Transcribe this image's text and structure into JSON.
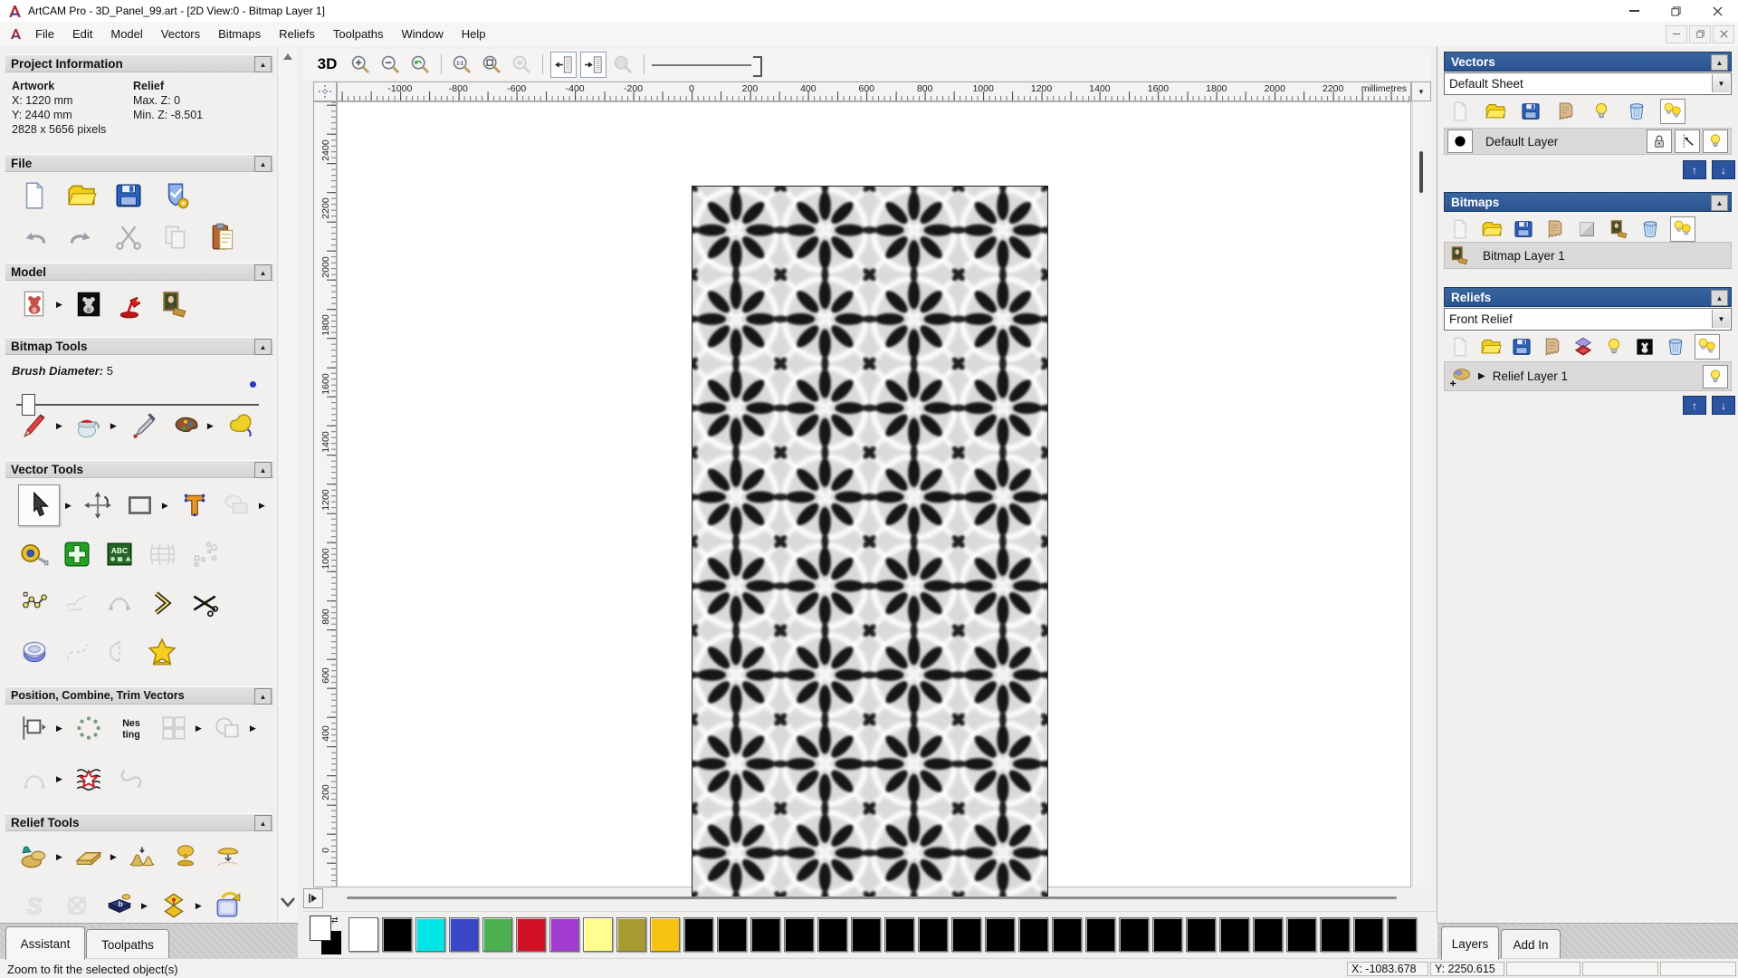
{
  "window": {
    "title": "ArtCAM Pro - 3D_Panel_99.art - [2D View:0 - Bitmap Layer 1]"
  },
  "menu": {
    "items": [
      "File",
      "Edit",
      "Model",
      "Vectors",
      "Bitmaps",
      "Reliefs",
      "Toolpaths",
      "Window",
      "Help"
    ]
  },
  "assistant": {
    "project_info": {
      "title": "Project Information",
      "artwork_label": "Artwork",
      "relief_label": "Relief",
      "x": "X: 1220 mm",
      "y": "Y: 2440 mm",
      "max_z": "Max. Z: 0",
      "min_z": "Min. Z: -8.501",
      "pixels": "2828 x 5656 pixels"
    },
    "section_titles": {
      "file": "File",
      "model": "Model",
      "bitmap": "Bitmap Tools",
      "vector": "Vector Tools",
      "position": "Position, Combine, Trim Vectors",
      "relief": "Relief Tools"
    },
    "brush_label": "Brush Diameter:",
    "brush_value": "5",
    "tabs": [
      {
        "label": "Assistant"
      },
      {
        "label": "Toolpaths"
      }
    ],
    "tools": {
      "file1": [
        {
          "n": "new-model",
          "s": "page"
        },
        {
          "n": "open-model",
          "s": "folder"
        },
        {
          "n": "save-model",
          "s": "floppy"
        },
        {
          "n": "model-properties",
          "s": "shield"
        }
      ],
      "file2": [
        {
          "n": "undo",
          "s": "undo"
        },
        {
          "n": "redo",
          "s": "redo"
        },
        {
          "n": "cut",
          "s": "scissors"
        },
        {
          "n": "copy",
          "s": "pages",
          "d": 1
        },
        {
          "n": "paste",
          "s": "clip"
        }
      ],
      "model": [
        {
          "n": "relief-preview",
          "s": "bear",
          "f": 1
        },
        {
          "n": "greyscale-view",
          "s": "beardark"
        },
        {
          "n": "light-material-settings",
          "s": "lamp"
        },
        {
          "n": "load-bitmap",
          "s": "mona"
        }
      ],
      "bitmap": [
        {
          "n": "paint-brush",
          "s": "pencil",
          "f": 1
        },
        {
          "n": "flood-fill",
          "s": "jar",
          "f": 1
        },
        {
          "n": "colour-picker",
          "s": "dropper"
        },
        {
          "n": "edit-palette",
          "s": "palette",
          "f": 1
        },
        {
          "n": "eraser",
          "s": "glove"
        }
      ],
      "vec1": [
        {
          "n": "select-vectors",
          "s": "cursor",
          "sel": 1,
          "f": 1
        },
        {
          "n": "transform-vectors",
          "s": "move"
        },
        {
          "n": "create-rectangle",
          "s": "recttool",
          "f": 1
        },
        {
          "n": "create-text",
          "s": "textT"
        },
        {
          "n": "create-ellipse",
          "s": "grayshapes",
          "d": 1,
          "f": 1
        }
      ],
      "vec2": [
        {
          "n": "measure-tool",
          "s": "tape"
        },
        {
          "n": "create-polyline",
          "s": "greencross"
        },
        {
          "n": "text-wizard",
          "s": "abc"
        },
        {
          "n": "envelope-distort",
          "s": "mesh",
          "d": 1
        },
        {
          "n": "paste-along-curve",
          "s": "dots",
          "d": 1
        }
      ],
      "vec3": [
        {
          "n": "node-editing",
          "s": "nodes"
        },
        {
          "n": "free-sketch",
          "s": "sketch",
          "d": 1
        },
        {
          "n": "fit-arcs",
          "s": "bezier",
          "d": 1
        },
        {
          "n": "vector-direction",
          "s": "chevron"
        },
        {
          "n": "trim-vectors",
          "s": "trim"
        }
      ],
      "vec4": [
        {
          "n": "fillet-tool",
          "s": "ring"
        },
        {
          "n": "smooth-vector",
          "s": "dashcurve",
          "d": 1
        },
        {
          "n": "mirror-vectors",
          "s": "halfgray",
          "d": 1
        },
        {
          "n": "vector-doctor",
          "s": "star"
        }
      ],
      "pos1": [
        {
          "n": "align-vectors",
          "s": "align",
          "f": 1
        },
        {
          "n": "circular-copy",
          "s": "circarray"
        },
        {
          "n": "nesting",
          "s": "nesting"
        },
        {
          "n": "block-copy",
          "s": "blockarray",
          "d": 1,
          "f": 1
        },
        {
          "n": "weld-vectors",
          "s": "weld",
          "d": 1,
          "f": 1
        }
      ],
      "pos2": [
        {
          "n": "join-vectors",
          "s": "joingray",
          "d": 1,
          "f": 1
        },
        {
          "n": "fit-vectors-to-curve",
          "s": "wavestar"
        },
        {
          "n": "morph-vectors",
          "s": "spiral",
          "d": 1
        }
      ],
      "rel1": [
        {
          "n": "sculpting",
          "s": "goldhand",
          "f": 1
        },
        {
          "n": "smoothing",
          "s": "goldbar",
          "f": 1
        },
        {
          "n": "add-subtract-relief",
          "s": "goldmound2"
        },
        {
          "n": "dome-relief",
          "s": "golddome"
        },
        {
          "n": "paste-relief",
          "s": "goldpaste"
        }
      ],
      "rel2": [
        {
          "n": "swept-profile",
          "s": "sgray",
          "d": 1
        },
        {
          "n": "weave-wizard",
          "s": "knot",
          "d": 1
        },
        {
          "n": "greyscale-from-relief",
          "s": "bookb",
          "f": 1
        },
        {
          "n": "offset-relief",
          "s": "goldoffset",
          "f": 1
        },
        {
          "n": "copy-transform-relief",
          "s": "bluecopy"
        }
      ],
      "rel3": [
        {
          "n": "star-wizard",
          "s": "bluestar"
        },
        {
          "n": "wrap-relief",
          "s": "wrap"
        },
        {
          "n": "shade-relief",
          "s": "redfan",
          "f": 1
        },
        {
          "n": "texture-relief",
          "s": "embossgray"
        },
        {
          "n": "angled-plane",
          "s": "plane"
        }
      ],
      "rel4": [
        {
          "n": "turn-relief",
          "s": "redhat"
        },
        {
          "n": "basket-weave",
          "s": "basket"
        },
        {
          "n": "cone-relief",
          "s": "bluecone"
        },
        {
          "n": "sphere-relief",
          "s": "blueglobe"
        },
        {
          "n": "two-rail-sweep",
          "s": "ybsplit"
        }
      ]
    }
  },
  "toolbar": {
    "view3d_label": "3D",
    "buttons": [
      {
        "n": "zoom-in",
        "s": "zoomin"
      },
      {
        "n": "zoom-out",
        "s": "zoomout"
      },
      {
        "n": "zoom-previous",
        "s": "zoomprev"
      },
      {
        "sep": 1
      },
      {
        "n": "zoom-1-to-1",
        "s": "zoom11"
      },
      {
        "n": "zoom-to-fit",
        "s": "zoomfit"
      },
      {
        "n": "zoom-to-object",
        "s": "zoomobj",
        "d": 1
      },
      {
        "sep": 1
      },
      {
        "n": "toggle-assistant-panel",
        "s": "panelleft",
        "pressed": 1
      },
      {
        "n": "toggle-layers-panel",
        "s": "panelright",
        "pressed": 1
      },
      {
        "n": "magnify-lens",
        "s": "zoomlens",
        "d": 1
      }
    ]
  },
  "rulers": {
    "units": "millimetres",
    "h_ticks": [
      -1000,
      -800,
      -600,
      -400,
      -200,
      0,
      200,
      400,
      600,
      800,
      1000,
      1200,
      1400,
      1600,
      1800,
      2000,
      2200
    ],
    "v_ticks": [
      2400,
      2200,
      2000,
      1800,
      1600,
      1400,
      1200,
      1000,
      800,
      600,
      400,
      200,
      0
    ]
  },
  "right": {
    "vectors": {
      "title": "Vectors",
      "sheet": "Default Sheet",
      "icons": [
        {
          "n": "new-vector-layer",
          "s": "page",
          "d": 1
        },
        {
          "n": "open-vector-layer",
          "s": "folder"
        },
        {
          "n": "save-vector-layer",
          "s": "floppy"
        },
        {
          "n": "merge-vector-layers",
          "s": "merge"
        },
        {
          "n": "toggle-layer-visibility",
          "s": "bulb"
        },
        {
          "n": "delete-vector-layer",
          "s": "trash"
        },
        {
          "n": "show-all-vector-layers",
          "s": "bulbs",
          "box": 1
        }
      ],
      "layer": "Default Layer"
    },
    "bitmaps": {
      "title": "Bitmaps",
      "icons": [
        {
          "n": "new-bitmap-layer",
          "s": "page",
          "d": 1
        },
        {
          "n": "open-bitmap-layer",
          "s": "folder"
        },
        {
          "n": "save-bitmap-layer",
          "s": "floppy"
        },
        {
          "n": "merge-bitmap-layers",
          "s": "merge"
        },
        {
          "n": "clear-bitmap-layer",
          "s": "graysq"
        },
        {
          "n": "bitmap-to-vector",
          "s": "mona"
        },
        {
          "n": "delete-bitmap-layer",
          "s": "trash"
        },
        {
          "n": "show-all-bitmap-layers",
          "s": "bulbs",
          "box": 1
        }
      ],
      "layer": "Bitmap Layer 1"
    },
    "reliefs": {
      "title": "Reliefs",
      "combo": "Front Relief",
      "icons": [
        {
          "n": "new-relief-layer",
          "s": "page",
          "d": 1
        },
        {
          "n": "open-relief-layer",
          "s": "folder"
        },
        {
          "n": "save-relief-layer",
          "s": "floppy"
        },
        {
          "n": "merge-relief-layers",
          "s": "merge"
        },
        {
          "n": "transfer-relief-layer",
          "s": "redlayers"
        },
        {
          "n": "toggle-layer-visibility",
          "s": "bulb"
        },
        {
          "n": "greyscale-preview",
          "s": "xray"
        },
        {
          "n": "delete-relief-layer",
          "s": "trash"
        },
        {
          "n": "show-all-relief-layers",
          "s": "bulbs",
          "box": 1
        }
      ],
      "layer": "Relief Layer 1"
    },
    "tabs": [
      {
        "label": "Layers"
      },
      {
        "label": "Add In"
      }
    ]
  },
  "palette": {
    "colors": [
      "#ffffff",
      "#000000",
      "#00e6e6",
      "#3747c8",
      "#4caf50",
      "#d01126",
      "#a23bd0",
      "#fffc90",
      "#a89a33",
      "#f5c211",
      "#000000",
      "#000000",
      "#000000",
      "#000000",
      "#000000",
      "#000000",
      "#000000",
      "#000000",
      "#000000",
      "#000000",
      "#000000",
      "#000000",
      "#000000",
      "#000000",
      "#000000",
      "#000000",
      "#000000",
      "#000000",
      "#000000",
      "#000000",
      "#000000",
      "#000000"
    ]
  },
  "status": {
    "message": "Zoom to fit the selected object(s)",
    "x": "X: -1083.678",
    "y": "Y: 2250.615"
  }
}
